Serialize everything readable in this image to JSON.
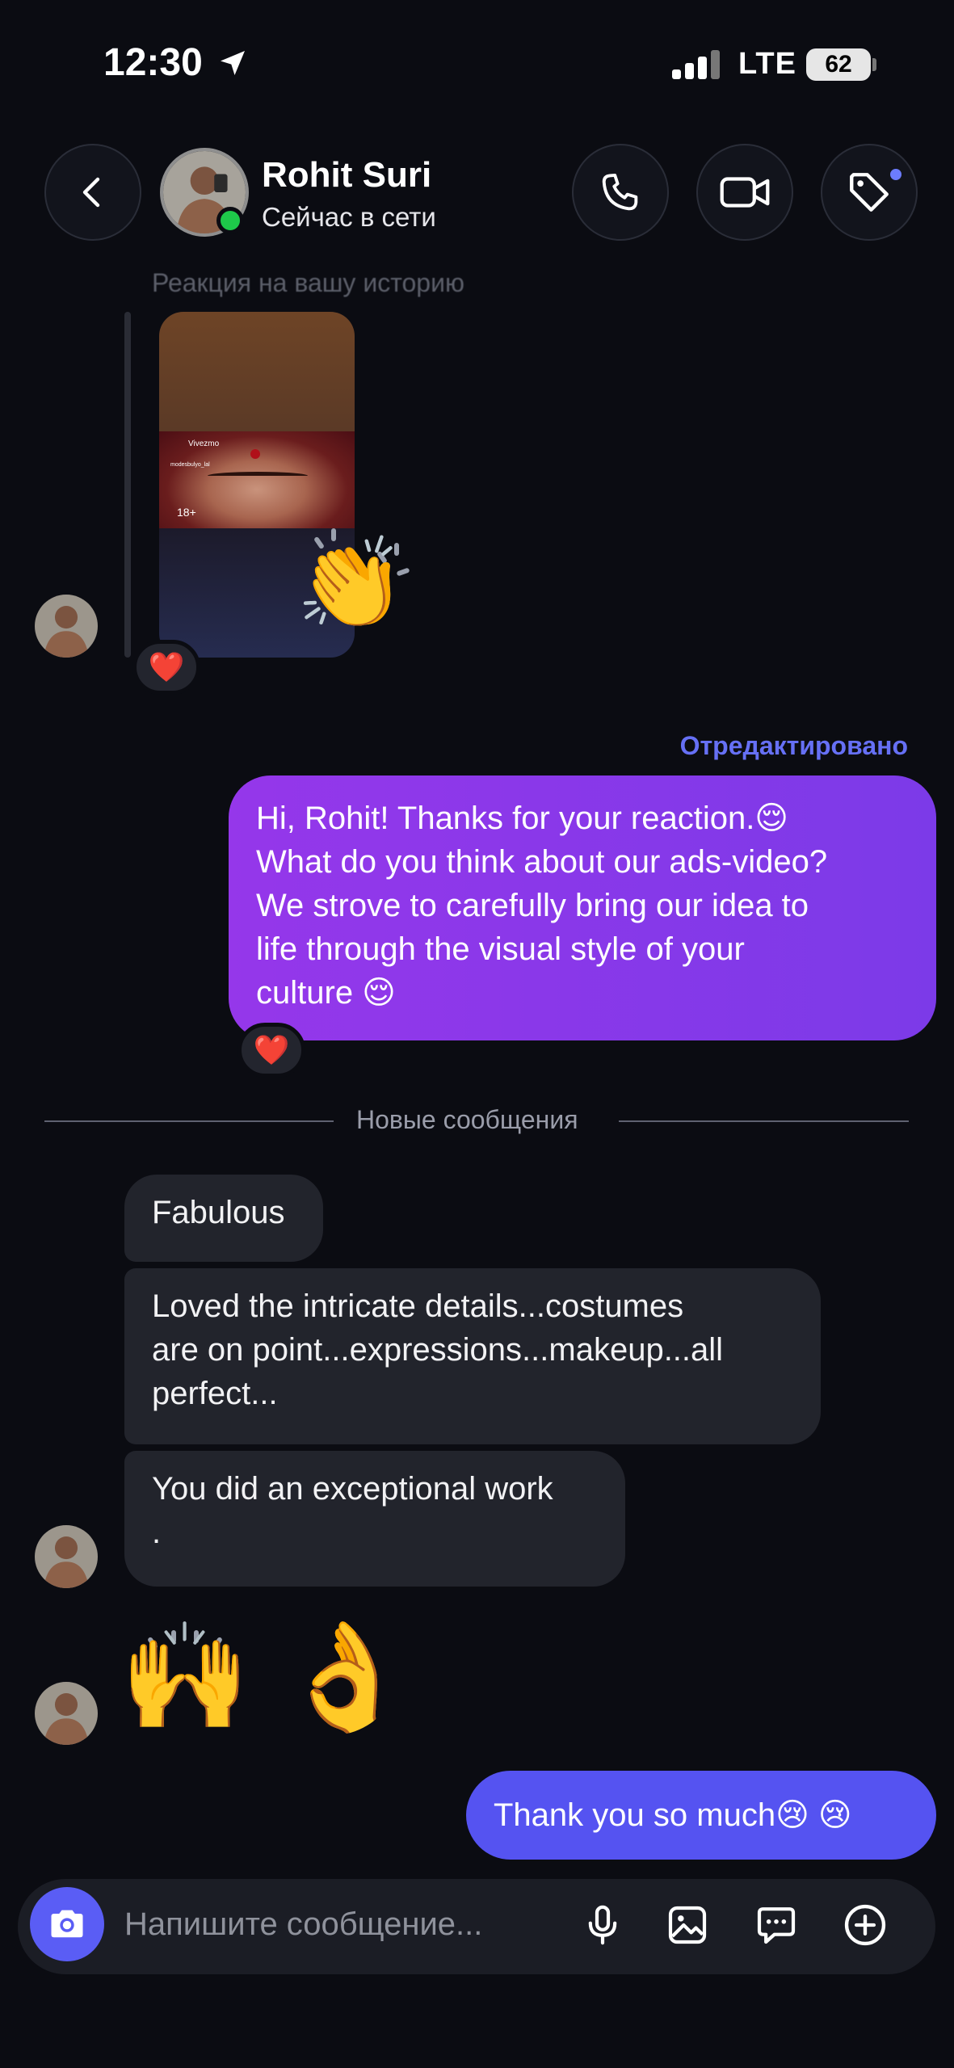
{
  "status_bar": {
    "time": "12:30",
    "network": "LTE",
    "battery": "62"
  },
  "header": {
    "name": "Rohit Suri",
    "status": "Сейчас в сети"
  },
  "story": {
    "caption": "Реакция на вашу историю",
    "brand": "Vivezmo",
    "user": "modesbulyo_lal",
    "age_label": "18+",
    "reaction": "❤️",
    "sticker": "👏"
  },
  "outgoing": {
    "edited_label": "Отредактировано",
    "lines": [
      "Hi, Rohit! Thanks for your reaction.😌",
      "What do you think about our ads-video?",
      "We strove to carefully bring our idea to",
      "life through the visual style of your",
      "culture 😌"
    ],
    "reaction": "❤️"
  },
  "divider": {
    "label": "Новые сообщения"
  },
  "incoming": {
    "msg1": "Fabulous",
    "msg2_lines": [
      "Loved the intricate details...costumes",
      "are on point...expressions...makeup...all",
      "perfect..."
    ],
    "msg3_lines": [
      "You did an exceptional work",
      "."
    ],
    "emoji": "🙌 👌"
  },
  "reply": {
    "text": "Thank you so much😢 😢"
  },
  "composer": {
    "placeholder": "Напишите сообщение..."
  },
  "colors": {
    "accent": "#5a5df5",
    "outgoing_bubble": "#8b38ea",
    "reply_bubble": "#5553f1",
    "edited": "#6670f5",
    "online": "#1ec94a"
  }
}
